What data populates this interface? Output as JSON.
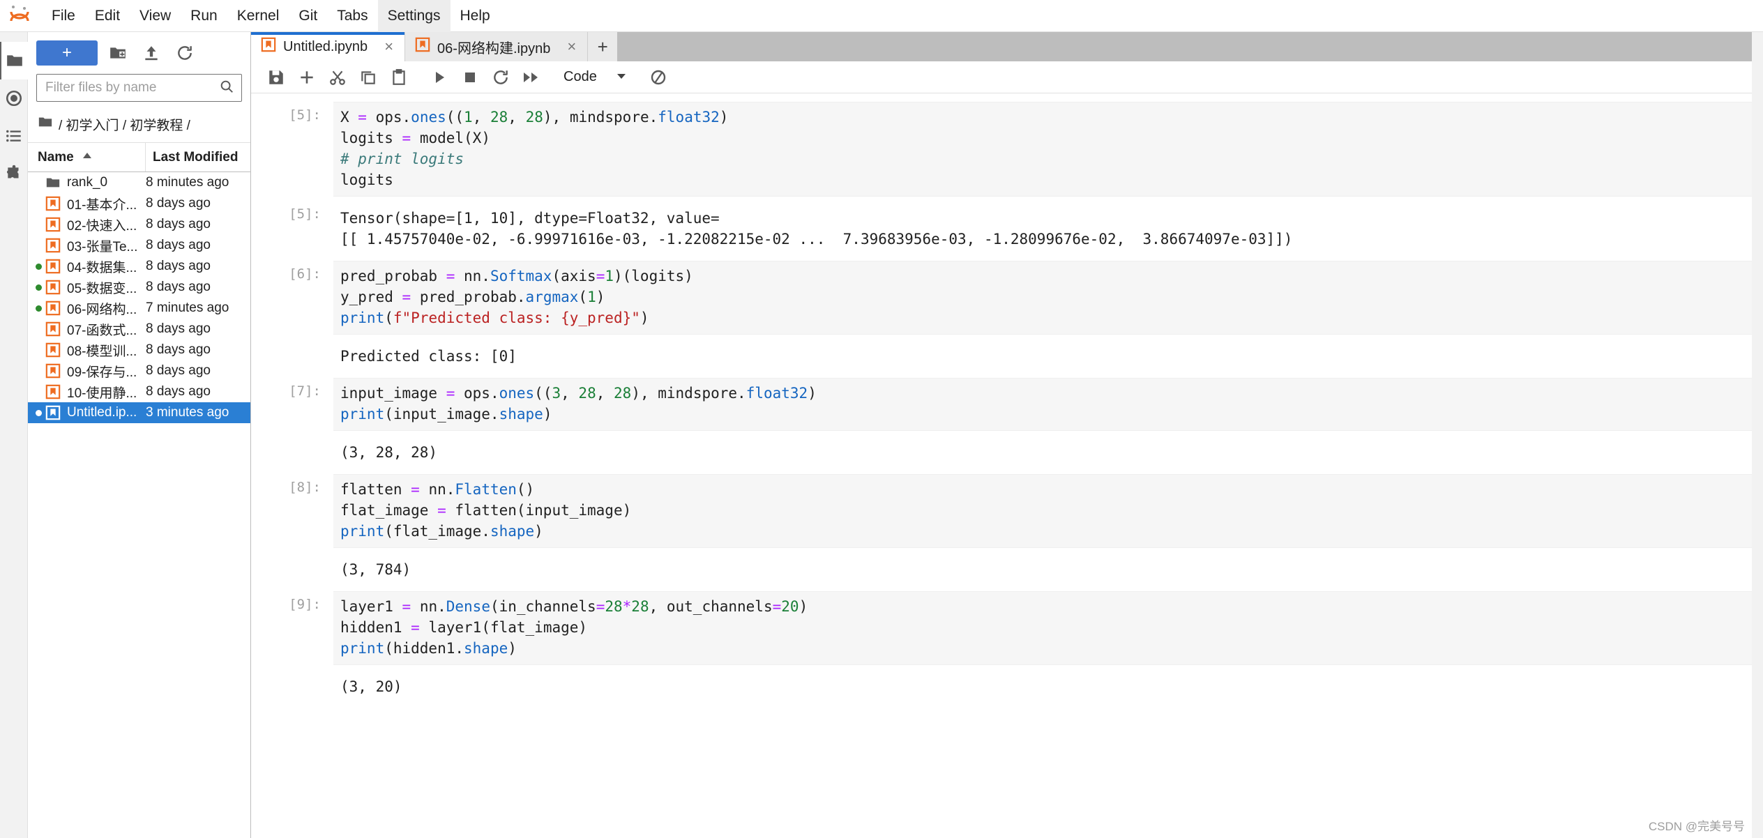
{
  "menubar": {
    "logo": "jupyter-logo",
    "items": [
      {
        "label": "File",
        "active": false
      },
      {
        "label": "Edit",
        "active": false
      },
      {
        "label": "View",
        "active": false
      },
      {
        "label": "Run",
        "active": false
      },
      {
        "label": "Kernel",
        "active": false
      },
      {
        "label": "Git",
        "active": false
      },
      {
        "label": "Tabs",
        "active": false
      },
      {
        "label": "Settings",
        "active": true
      },
      {
        "label": "Help",
        "active": false
      }
    ]
  },
  "activitybar": {
    "items": [
      {
        "name": "file-browser-icon",
        "selected": true
      },
      {
        "name": "running-terminals-icon",
        "selected": false
      },
      {
        "name": "table-of-contents-icon",
        "selected": false
      },
      {
        "name": "extension-manager-icon",
        "selected": false
      }
    ]
  },
  "filebrowser": {
    "new_launcher_label": "+",
    "new_folder_icon": "new-folder-icon",
    "upload_icon": "upload-icon",
    "refresh_icon": "refresh-icon",
    "filter": {
      "value": "",
      "placeholder": "Filter files by name",
      "search_icon": "search-icon"
    },
    "breadcrumb": "/ 初学入门 / 初学教程 /",
    "breadcrumb_icon": "folder-icon",
    "columns": {
      "name": "Name",
      "last_modified": "Last Modified"
    },
    "sort_icon": "sort-ascending-icon",
    "rows": [
      {
        "name": "rank_0",
        "modified": "8 minutes ago",
        "icon": "folder-icon",
        "running": false,
        "selected": false
      },
      {
        "name": "01-基本介...",
        "modified": "8 days ago",
        "icon": "notebook-icon",
        "running": false,
        "selected": false
      },
      {
        "name": "02-快速入...",
        "modified": "8 days ago",
        "icon": "notebook-icon",
        "running": false,
        "selected": false
      },
      {
        "name": "03-张量Te...",
        "modified": "8 days ago",
        "icon": "notebook-icon",
        "running": false,
        "selected": false
      },
      {
        "name": "04-数据集...",
        "modified": "8 days ago",
        "icon": "notebook-icon",
        "running": true,
        "selected": false
      },
      {
        "name": "05-数据变...",
        "modified": "8 days ago",
        "icon": "notebook-icon",
        "running": true,
        "selected": false
      },
      {
        "name": "06-网络构...",
        "modified": "7 minutes ago",
        "icon": "notebook-icon",
        "running": true,
        "selected": false
      },
      {
        "name": "07-函数式...",
        "modified": "8 days ago",
        "icon": "notebook-icon",
        "running": false,
        "selected": false
      },
      {
        "name": "08-模型训...",
        "modified": "8 days ago",
        "icon": "notebook-icon",
        "running": false,
        "selected": false
      },
      {
        "name": "09-保存与...",
        "modified": "8 days ago",
        "icon": "notebook-icon",
        "running": false,
        "selected": false
      },
      {
        "name": "10-使用静...",
        "modified": "8 days ago",
        "icon": "notebook-icon",
        "running": false,
        "selected": false
      },
      {
        "name": "Untitled.ip...",
        "modified": "3 minutes ago",
        "icon": "notebook-icon",
        "running": true,
        "selected": true
      }
    ]
  },
  "tabs": {
    "items": [
      {
        "label": "Untitled.ipynb",
        "icon": "notebook-icon",
        "active": true,
        "close": "×"
      },
      {
        "label": "06-网络构建.ipynb",
        "icon": "notebook-icon",
        "active": false,
        "close": "×"
      }
    ],
    "add_label": "+"
  },
  "notebook_toolbar": {
    "buttons": [
      {
        "name": "save-button",
        "icon": "save-icon"
      },
      {
        "name": "insert-cell-button",
        "icon": "plus-icon"
      },
      {
        "name": "cut-cells-button",
        "icon": "scissors-icon"
      },
      {
        "name": "copy-cells-button",
        "icon": "copy-icon"
      },
      {
        "name": "paste-cells-button",
        "icon": "clipboard-icon"
      },
      {
        "name": "run-cell-button",
        "icon": "play-icon"
      },
      {
        "name": "interrupt-kernel-button",
        "icon": "stop-icon"
      },
      {
        "name": "restart-kernel-button",
        "icon": "restart-icon"
      },
      {
        "name": "restart-run-all-button",
        "icon": "fast-forward-icon"
      }
    ],
    "cell_type": "Code",
    "cell_type_chevron": "chevron-down-icon",
    "kernel_busy_icon": "kernel-busy-icon"
  },
  "notebook": {
    "cells": [
      {
        "prompt": "[5]:",
        "type": "input",
        "lines": [
          [
            {
              "t": "X ",
              "c": ""
            },
            {
              "t": "=",
              "c": "op"
            },
            {
              "t": " ops.",
              "c": ""
            },
            {
              "t": "ones",
              "c": "fn"
            },
            {
              "t": "((",
              "c": ""
            },
            {
              "t": "1",
              "c": "num"
            },
            {
              "t": ", ",
              "c": ""
            },
            {
              "t": "28",
              "c": "num"
            },
            {
              "t": ", ",
              "c": ""
            },
            {
              "t": "28",
              "c": "num"
            },
            {
              "t": "), mindspore.",
              "c": ""
            },
            {
              "t": "float32",
              "c": "fn"
            },
            {
              "t": ")",
              "c": ""
            }
          ],
          [
            {
              "t": "logits ",
              "c": ""
            },
            {
              "t": "=",
              "c": "op"
            },
            {
              "t": " model(X)",
              "c": ""
            }
          ],
          [
            {
              "t": "# print logits",
              "c": "com"
            }
          ],
          [
            {
              "t": "logits",
              "c": ""
            }
          ]
        ]
      },
      {
        "prompt": "[5]:",
        "type": "output",
        "lines": [
          [
            {
              "t": "Tensor(shape=[1, 10], dtype=Float32, value=",
              "c": ""
            }
          ],
          [
            {
              "t": "[[ 1.45757040e-02, -6.99971616e-03, -1.22082215e-02 ...  7.39683956e-03, -1.28099676e-02,  3.86674097e-03]])",
              "c": ""
            }
          ]
        ]
      },
      {
        "prompt": "[6]:",
        "type": "input",
        "lines": [
          [
            {
              "t": "pred_probab ",
              "c": ""
            },
            {
              "t": "=",
              "c": "op"
            },
            {
              "t": " nn.",
              "c": ""
            },
            {
              "t": "Softmax",
              "c": "fn"
            },
            {
              "t": "(axis",
              "c": ""
            },
            {
              "t": "=",
              "c": "op"
            },
            {
              "t": "1",
              "c": "num"
            },
            {
              "t": ")(logits)",
              "c": ""
            }
          ],
          [
            {
              "t": "y_pred ",
              "c": ""
            },
            {
              "t": "=",
              "c": "op"
            },
            {
              "t": " pred_probab.",
              "c": ""
            },
            {
              "t": "argmax",
              "c": "fn"
            },
            {
              "t": "(",
              "c": ""
            },
            {
              "t": "1",
              "c": "num"
            },
            {
              "t": ")",
              "c": ""
            }
          ],
          [
            {
              "t": "print",
              "c": "fn"
            },
            {
              "t": "(",
              "c": ""
            },
            {
              "t": "f\"Predicted class: {y_pred}\"",
              "c": "str"
            },
            {
              "t": ")",
              "c": ""
            }
          ]
        ]
      },
      {
        "prompt": "",
        "type": "output",
        "lines": [
          [
            {
              "t": "Predicted class: [0]",
              "c": ""
            }
          ]
        ]
      },
      {
        "prompt": "[7]:",
        "type": "input",
        "lines": [
          [
            {
              "t": "input_image ",
              "c": ""
            },
            {
              "t": "=",
              "c": "op"
            },
            {
              "t": " ops.",
              "c": ""
            },
            {
              "t": "ones",
              "c": "fn"
            },
            {
              "t": "((",
              "c": ""
            },
            {
              "t": "3",
              "c": "num"
            },
            {
              "t": ", ",
              "c": ""
            },
            {
              "t": "28",
              "c": "num"
            },
            {
              "t": ", ",
              "c": ""
            },
            {
              "t": "28",
              "c": "num"
            },
            {
              "t": "), mindspore.",
              "c": ""
            },
            {
              "t": "float32",
              "c": "fn"
            },
            {
              "t": ")",
              "c": ""
            }
          ],
          [
            {
              "t": "print",
              "c": "fn"
            },
            {
              "t": "(input_image.",
              "c": ""
            },
            {
              "t": "shape",
              "c": "fn"
            },
            {
              "t": ")",
              "c": ""
            }
          ]
        ]
      },
      {
        "prompt": "",
        "type": "output",
        "lines": [
          [
            {
              "t": "(3, 28, 28)",
              "c": ""
            }
          ]
        ]
      },
      {
        "prompt": "[8]:",
        "type": "input",
        "lines": [
          [
            {
              "t": "flatten ",
              "c": ""
            },
            {
              "t": "=",
              "c": "op"
            },
            {
              "t": " nn.",
              "c": ""
            },
            {
              "t": "Flatten",
              "c": "fn"
            },
            {
              "t": "()",
              "c": ""
            }
          ],
          [
            {
              "t": "flat_image ",
              "c": ""
            },
            {
              "t": "=",
              "c": "op"
            },
            {
              "t": " flatten(input_image)",
              "c": ""
            }
          ],
          [
            {
              "t": "print",
              "c": "fn"
            },
            {
              "t": "(flat_image.",
              "c": ""
            },
            {
              "t": "shape",
              "c": "fn"
            },
            {
              "t": ")",
              "c": ""
            }
          ]
        ]
      },
      {
        "prompt": "",
        "type": "output",
        "lines": [
          [
            {
              "t": "(3, 784)",
              "c": ""
            }
          ]
        ]
      },
      {
        "prompt": "[9]:",
        "type": "input",
        "lines": [
          [
            {
              "t": "layer1 ",
              "c": ""
            },
            {
              "t": "=",
              "c": "op"
            },
            {
              "t": " nn.",
              "c": ""
            },
            {
              "t": "Dense",
              "c": "fn"
            },
            {
              "t": "(in_channels",
              "c": ""
            },
            {
              "t": "=",
              "c": "op"
            },
            {
              "t": "28",
              "c": "num"
            },
            {
              "t": "*",
              "c": "op"
            },
            {
              "t": "28",
              "c": "num"
            },
            {
              "t": ", out_channels",
              "c": ""
            },
            {
              "t": "=",
              "c": "op"
            },
            {
              "t": "20",
              "c": "num"
            },
            {
              "t": ")",
              "c": ""
            }
          ],
          [
            {
              "t": "hidden1 ",
              "c": ""
            },
            {
              "t": "=",
              "c": "op"
            },
            {
              "t": " layer1(flat_image)",
              "c": ""
            }
          ],
          [
            {
              "t": "print",
              "c": "fn"
            },
            {
              "t": "(hidden1.",
              "c": ""
            },
            {
              "t": "shape",
              "c": "fn"
            },
            {
              "t": ")",
              "c": ""
            }
          ]
        ]
      },
      {
        "prompt": "",
        "type": "output",
        "lines": [
          [
            {
              "t": "(3, 20)",
              "c": ""
            }
          ]
        ]
      }
    ]
  },
  "watermark": "CSDN @完美号号",
  "colors": {
    "accent_blue": "#2a7fd4",
    "tab_active_bar": "#1f6fd0",
    "new_button": "#3f77cf",
    "running_dot": "#2e8b2e",
    "notebook_icon": "#ee6c21",
    "cell_bg": "#f6f6f6"
  }
}
